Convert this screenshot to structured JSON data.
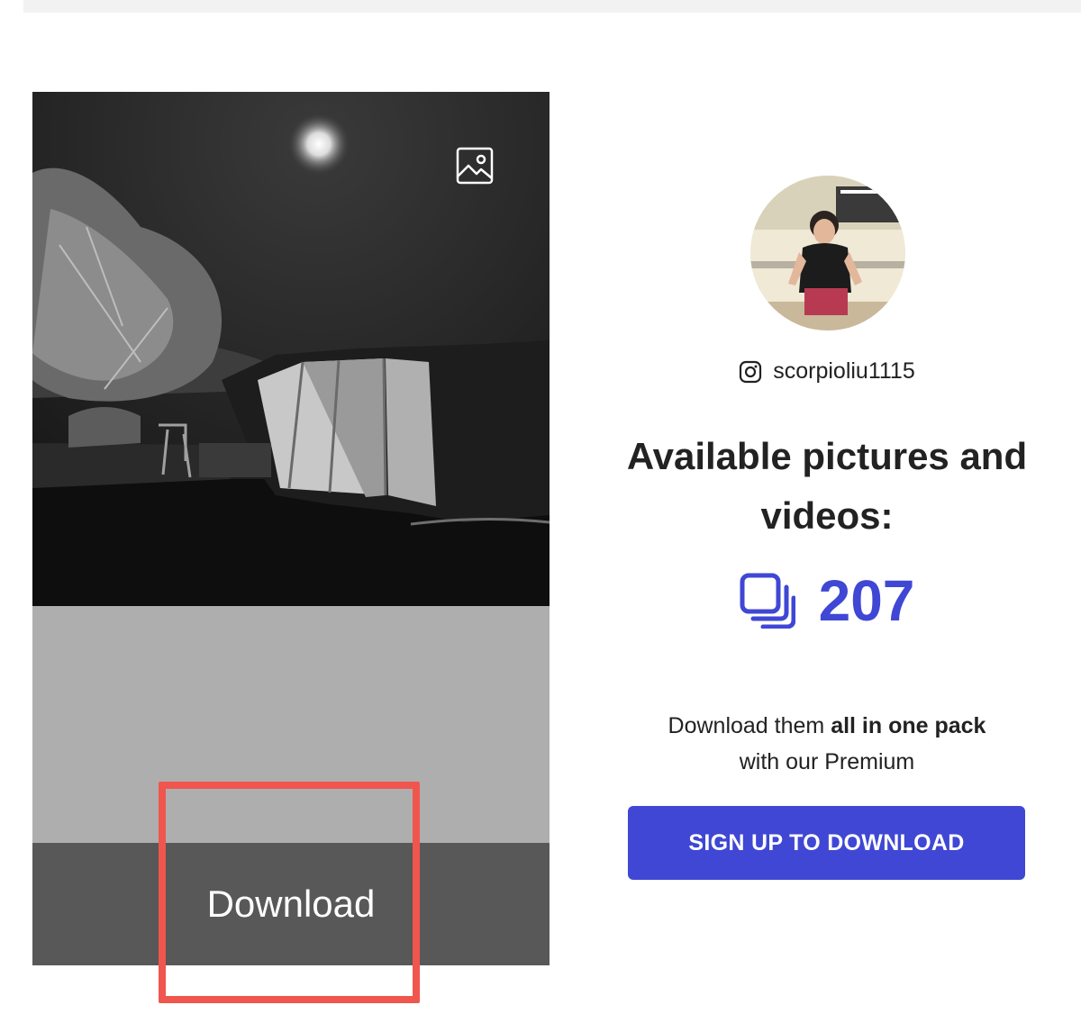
{
  "post": {
    "media_type_icon": "image-icon",
    "download_label": "Download"
  },
  "profile": {
    "platform_icon": "instagram-icon",
    "username": "scorpioliu1115"
  },
  "stats": {
    "heading": "Available pictures and videos:",
    "count_icon": "gallery-stack-icon",
    "count": "207"
  },
  "promo": {
    "text_before": "Download them ",
    "text_bold": "all in one pack",
    "text_after": "with our Premium"
  },
  "cta": {
    "signup_label": "SIGN UP TO DOWNLOAD"
  },
  "colors": {
    "accent": "#3f47d4",
    "highlight": "#f0564e",
    "download_bar": "#585858"
  }
}
